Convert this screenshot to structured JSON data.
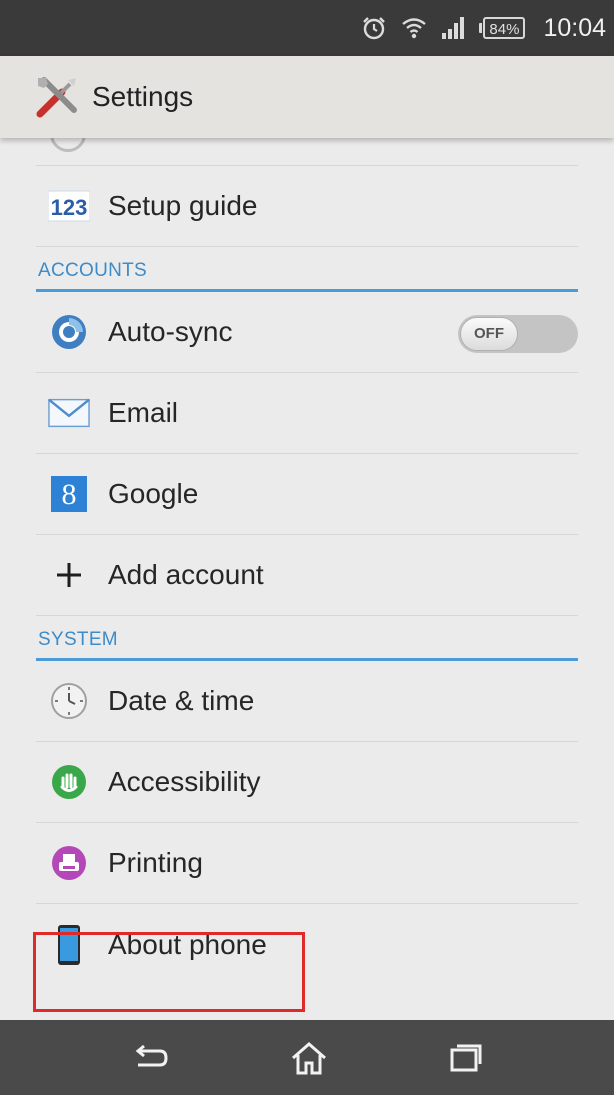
{
  "status_bar": {
    "battery_level": "84%",
    "time": "10:04",
    "icons": [
      "alarm-icon",
      "wifi-icon",
      "signal-icon",
      "battery-icon"
    ]
  },
  "action_bar": {
    "title": "Settings",
    "icon": "settings-tools-icon"
  },
  "sections": {
    "accounts": "ACCOUNTS",
    "system": "SYSTEM"
  },
  "items": {
    "setup_guide": "Setup guide",
    "auto_sync": "Auto-sync",
    "auto_sync_state": "OFF",
    "email": "Email",
    "google": "Google",
    "google_glyph": "8",
    "setup_glyph": "123",
    "add_account": "Add account",
    "date_time": "Date & time",
    "accessibility": "Accessibility",
    "printing": "Printing",
    "about_phone": "About phone"
  },
  "nav_bar": {
    "icons": [
      "back-icon",
      "home-icon",
      "recent-apps-icon"
    ]
  },
  "colors": {
    "accent": "#3d8bc9",
    "highlight": "#e02a2a",
    "status_bar_bg": "#3a3a3a",
    "nav_bar_bg": "#4a4a4a"
  }
}
